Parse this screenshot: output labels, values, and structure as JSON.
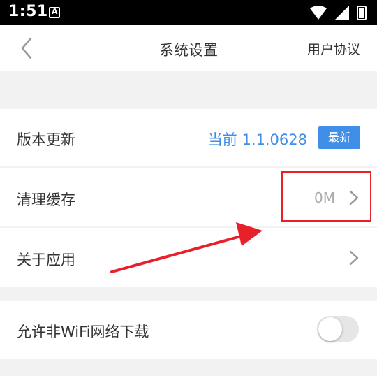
{
  "status_bar": {
    "time": "1:51"
  },
  "header": {
    "title": "系统设置",
    "agreement_label": "用户协议"
  },
  "settings": {
    "version": {
      "label": "版本更新",
      "current": "当前 1.1.0628",
      "badge": "最新"
    },
    "cache": {
      "label": "清理缓存",
      "size": "0M"
    },
    "about": {
      "label": "关于应用"
    },
    "wifi": {
      "label": "允许非WiFi网络下载",
      "enabled": false
    }
  },
  "colors": {
    "accent": "#3f8ee8",
    "annotation": "#e8202a"
  }
}
